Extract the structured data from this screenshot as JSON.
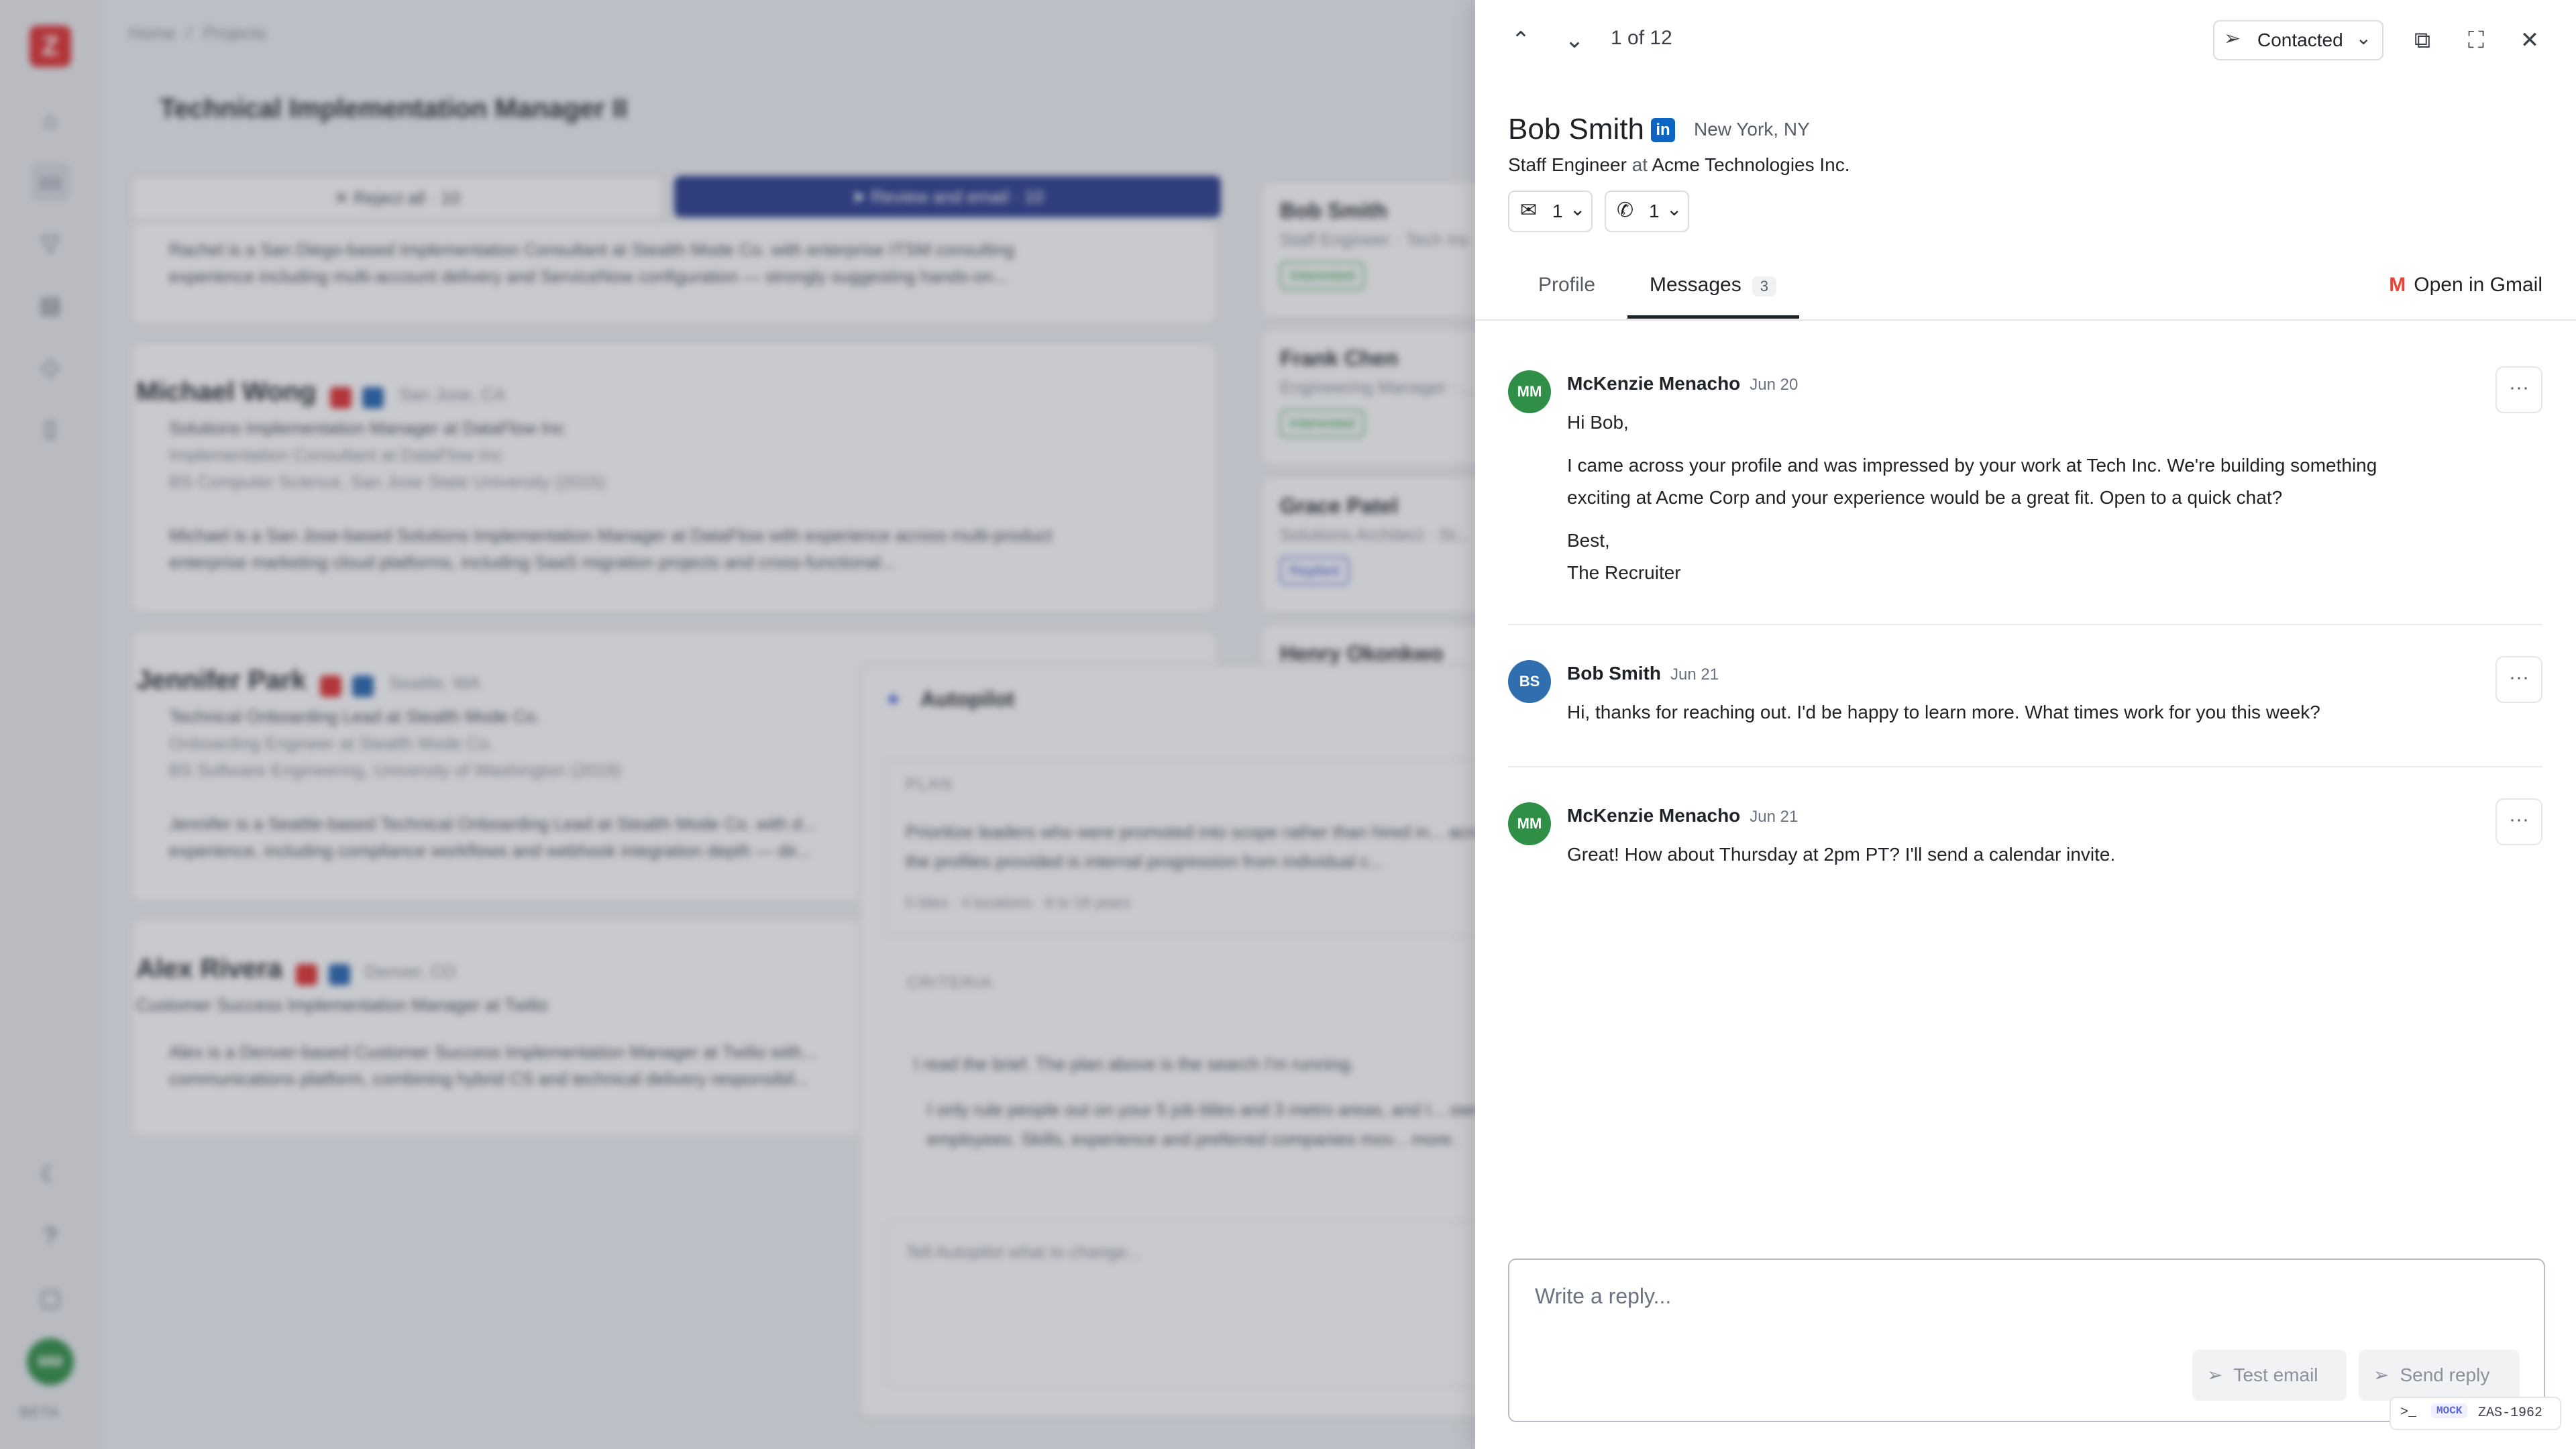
{
  "background": {
    "breadcrumb": [
      "Home",
      "/",
      "Projects"
    ],
    "page_title": "Technical Implementation Manager II",
    "reject_all": "Reject all · 10",
    "review_and_email": "Review and email · 10",
    "candidates": [
      {
        "name": "",
        "location": "",
        "lines": [],
        "summary": "Rachel is a San Diego-based Implementation Consultant at Stealth Mode Co. with enterprise ITSM consulting experience including multi-account delivery and ServiceNow configuration — strongly suggesting hands-on..."
      },
      {
        "name": "Michael Wong",
        "location": "San Jose, CA",
        "lines": [
          "Solutions Implementation Manager at DataFlow Inc",
          "Implementation Consultant at DataFlow Inc",
          "BS Computer Science, San Jose State University (2015)"
        ],
        "summary": "Michael is a San Jose-based Solutions Implementation Manager at DataFlow with experience across multi-product enterprise marketing cloud platforms, including SaaS migration projects and cross-functional..."
      },
      {
        "name": "Jennifer Park",
        "location": "Seattle, WA",
        "lines": [
          "Technical Onboarding Lead at Stealth Mode Co.",
          "Onboarding Engineer at Stealth Mode Co.",
          "BS Software Engineering, University of Washington (2019)"
        ],
        "summary": "Jennifer is a Seattle-based Technical Onboarding Lead at Stealth Mode Co. with d... experience, including compliance workflows and webhook integration depth — dir..."
      },
      {
        "name": "Alex Rivera",
        "location": "Denver, CO",
        "lines": [
          "Customer Success Implementation Manager at Twilio"
        ],
        "summary": "Alex is a Denver-based Customer Success Implementation Manager at Twilio with... communications platform, combining hybrid CS and technical delivery responsibil..."
      }
    ],
    "side_cards": [
      {
        "name": "Bob Smith",
        "role": "Staff Engineer · Tech Inc",
        "tag": "Interested"
      },
      {
        "name": "Frank Chen",
        "role": "Engineering Manager · ...",
        "tag": "Interested"
      },
      {
        "name": "Grace Patel",
        "role": "Solutions Architect · St...",
        "tag": "Replied"
      },
      {
        "name": "Henry Okonkwo",
        "role": "",
        "tag": ""
      }
    ],
    "autopilot": {
      "title": "Autopilot",
      "plan_label": "PLAN",
      "plan_text": "Prioritize leaders who were promoted into scope rather than hired in... across the profiles provided is internal progression from individual c...",
      "plan_meta": "5 titles · 4 locations · 8 to 18 years",
      "criteria_label": "CRITERIA",
      "note": "I read the brief. The plan above is the search I'm running.",
      "note_detail": "I only rule people out on your 5 job titles and 3 metro areas, and I... own employees. Skills, experience and preferred companies mov... more.",
      "input_placeholder": "Tell Autopilot what to change..."
    },
    "beta": "BETA",
    "avatar_initials": "MM"
  },
  "drawer": {
    "counter": "1 of 12",
    "status": "Contacted",
    "person": {
      "name": "Bob Smith",
      "location": "New York, NY",
      "title": "Staff Engineer",
      "at": "at",
      "company": "Acme Technologies Inc.",
      "email_count": "1",
      "phone_count": "1"
    },
    "tabs": {
      "profile": "Profile",
      "messages": "Messages",
      "messages_count": "3"
    },
    "open_in_gmail": "Open in Gmail",
    "messages": [
      {
        "initials": "MM",
        "author": "McKenzie Menacho",
        "date": "Jun 20",
        "avatar_color": "#2f8f46",
        "paragraphs": [
          "Hi Bob,",
          "I came across your profile and was impressed by your work at Tech Inc. We're building something exciting at Acme Corp and your experience would be a great fit. Open to a quick chat?",
          "Best,\nThe Recruiter"
        ]
      },
      {
        "initials": "BS",
        "author": "Bob Smith",
        "date": "Jun 21",
        "avatar_color": "#2f6fb0",
        "paragraphs": [
          "Hi, thanks for reaching out. I'd be happy to learn more. What times work for you this week?"
        ]
      },
      {
        "initials": "MM",
        "author": "McKenzie Menacho",
        "date": "Jun 21",
        "avatar_color": "#2f8f46",
        "paragraphs": [
          "Great! How about Thursday at 2pm PT? I'll send a calendar invite."
        ]
      }
    ],
    "reply": {
      "placeholder": "Write a reply...",
      "test_email": "Test email",
      "send_reply": "Send reply"
    }
  },
  "mock_badge": {
    "tag": "MOCK",
    "code": "ZAS-1962"
  },
  "colors": {
    "brand_red": "#e03131",
    "primary_blue": "#2c3d8f",
    "linkedin": "#0a66c2",
    "interested_green": "#2f9e44"
  }
}
